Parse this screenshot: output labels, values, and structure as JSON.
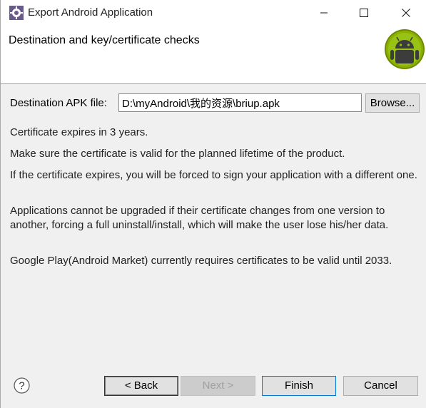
{
  "window": {
    "title": "Export Android Application"
  },
  "banner": {
    "title": "Destination and key/certificate checks"
  },
  "destination": {
    "label": "Destination APK file:",
    "value": "D:\\myAndroid\\我的资源\\briup.apk",
    "browse_label": "Browse..."
  },
  "messages": [
    "Certificate expires in 3 years.",
    "Make sure the certificate is valid for the planned lifetime of the product.",
    "If the certificate expires, you will be forced to sign your application with a different one.",
    "Applications cannot be upgraded if their certificate changes from one version to another, forcing a full uninstall/install, which will make the user lose his/her data.",
    "Google Play(Android Market) currently requires certificates to be valid until 2033."
  ],
  "buttons": {
    "back_label": "< Back",
    "next_label": "Next >",
    "finish_label": "Finish",
    "cancel_label": "Cancel"
  },
  "colors": {
    "android_green": "#8ab000",
    "focus_blue": "#0078d7"
  },
  "icons": {
    "app": "eclipse-gear-icon",
    "help": "help-icon",
    "minimize": "minimize-icon",
    "maximize": "maximize-icon",
    "close": "close-icon",
    "banner": "android-logo"
  }
}
